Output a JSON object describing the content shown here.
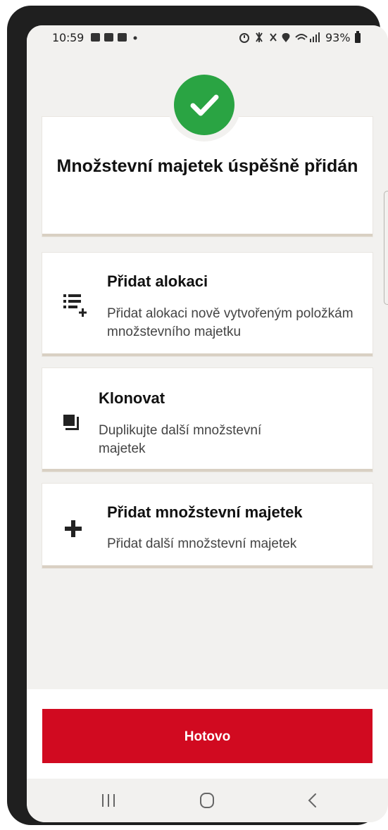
{
  "status_bar": {
    "time": "10:59",
    "left_icons": "▣ ▣ ▣ •",
    "right_icons": "⏰ ✱ ✕ ▼ ≡",
    "battery": "93%"
  },
  "success": {
    "title": "Množstevní majetek úspěšně přidán",
    "accent_color": "#2aa443"
  },
  "options": [
    {
      "title": "Přidat alokaci",
      "description": "Přidat alokaci nově vytvořeným položkám množstevního majetku",
      "icon": "list-add-icon"
    },
    {
      "title": "Klonovat",
      "description": "Duplikujte další množstevní majetek",
      "icon": "copy-icon"
    },
    {
      "title": "Přidat množstevní majetek",
      "description": "Přidat další množstevní majetek",
      "icon": "plus-icon"
    }
  ],
  "done_button": {
    "label": "Hotovo",
    "color": "#d10a20"
  },
  "nav": {
    "recents": "recents-icon",
    "home": "home-icon",
    "back": "back-icon"
  }
}
